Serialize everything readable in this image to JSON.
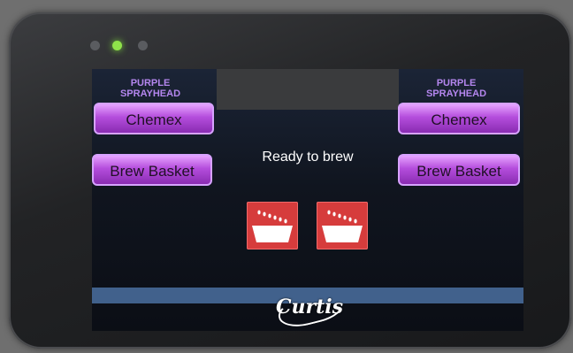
{
  "screen": {
    "left_panel": {
      "sprayhead_line1": "PURPLE",
      "sprayhead_line2": "SPRAYHEAD",
      "chemex_label": "Chemex",
      "brew_basket_label": "Brew Basket"
    },
    "right_panel": {
      "sprayhead_line1": "PURPLE",
      "sprayhead_line2": "SPRAYHEAD",
      "chemex_label": "Chemex",
      "brew_basket_label": "Brew Basket"
    },
    "status_text": "Ready to brew",
    "brand_logo_text": "Curtis",
    "icons": [
      "brew-basket-icon",
      "brew-basket-icon"
    ]
  },
  "colors": {
    "button_purple": "#b44ddc",
    "label_purple": "#b486ee",
    "basket_red": "#d63c3c",
    "status_led_green": "#8fe24a",
    "bottom_bar_blue": "#41618c"
  }
}
